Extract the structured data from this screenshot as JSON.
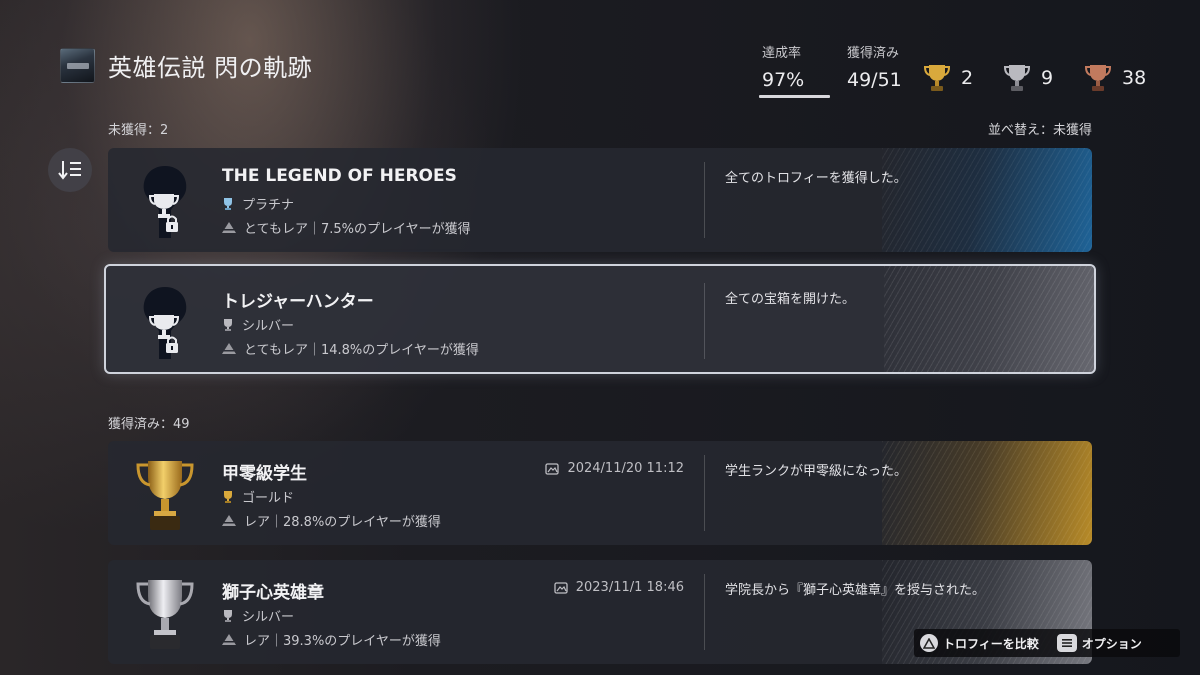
{
  "header": {
    "game_title": "英雄伝説 閃の軌跡",
    "completion_label": "達成率",
    "completion_value": "97%",
    "earned_label": "獲得済み",
    "earned_value": "49/51",
    "counts": {
      "gold": "2",
      "silver": "9",
      "bronze": "38"
    }
  },
  "unearned_section": {
    "label": "未獲得：2",
    "sort_label": "並べ替え：未獲得"
  },
  "earned_section": {
    "label": "獲得済み：49"
  },
  "trophies": [
    {
      "name": "THE LEGEND OF HEROES",
      "grade": "プラチナ",
      "rarity": "とてもレア｜7.5%のプレイヤーが獲得",
      "description": "全てのトロフィーを獲得した。",
      "locked": true
    },
    {
      "name": "トレジャーハンター",
      "grade": "シルバー",
      "rarity": "とてもレア｜14.8%のプレイヤーが獲得",
      "description": "全ての宝箱を開けた。",
      "locked": true,
      "selected": true
    },
    {
      "name": "甲零級学生",
      "grade": "ゴールド",
      "rarity": "レア｜28.8%のプレイヤーが獲得",
      "description": "学生ランクが甲零級になった。",
      "date": "2024/11/20  11:12",
      "locked": false
    },
    {
      "name": "獅子心英雄章",
      "grade": "シルバー",
      "rarity": "レア｜39.3%のプレイヤーが獲得",
      "description": "学院長から『獅子心英雄章』を授与された。",
      "date": "2023/11/1  18:46",
      "locked": false
    }
  ],
  "footer": {
    "compare_label": "トロフィーを比較",
    "options_label": "オプション"
  },
  "colors": {
    "gold": "#d9a93c",
    "silver": "#b9b9bf",
    "bronze": "#c27a5e",
    "platinum": "#8fc3e6"
  }
}
